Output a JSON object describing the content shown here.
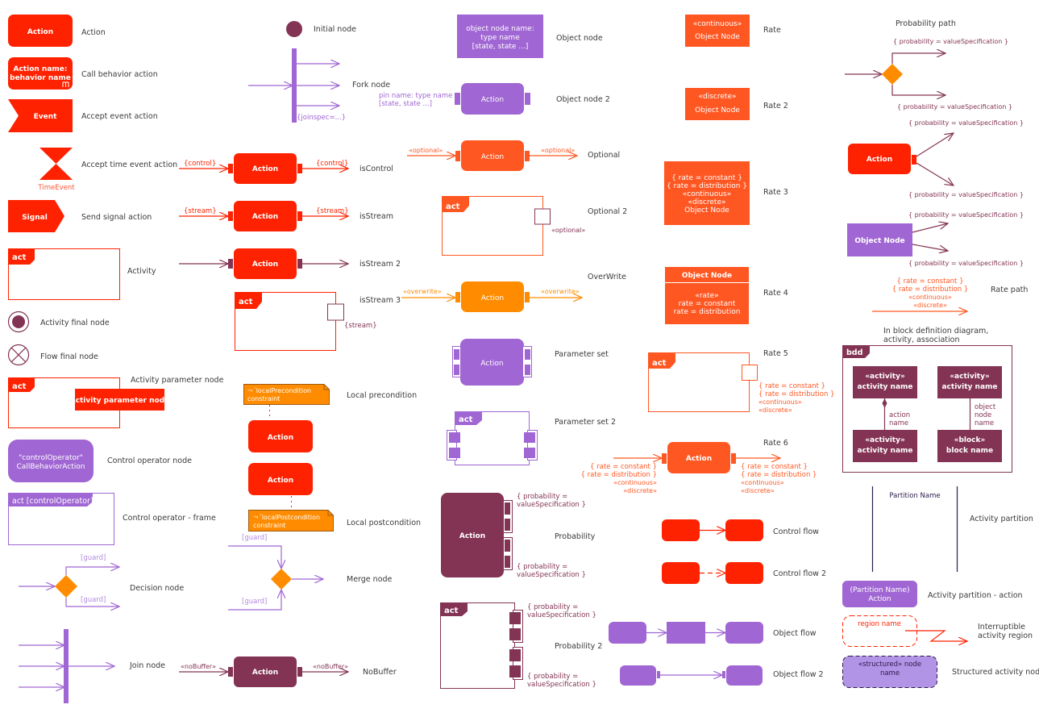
{
  "colors": {
    "red": "#ff2200",
    "orange": "#ff8c00",
    "coral": "#ff5722",
    "purple": "#a066d3",
    "plum": "#833454",
    "light_purple": "#b294e6",
    "text": "#3a3a3a"
  },
  "col1": {
    "action": {
      "shape": "Action",
      "label": "Action"
    },
    "call_behavior": {
      "shape_line1": "Action name:",
      "shape_line2": "behavior name",
      "label": "Call behavior action"
    },
    "accept_event": {
      "shape": "Event",
      "label": "Accept event action"
    },
    "accept_time": {
      "caption": "TimeEvent",
      "label": "Accept time event action"
    },
    "send_signal": {
      "shape": "Signal",
      "label": "Send signal action"
    },
    "activity": {
      "tag": "act",
      "label": "Activity"
    },
    "activity_final": {
      "label": "Activity final node"
    },
    "flow_final": {
      "label": "Flow final node"
    },
    "activity_param": {
      "tag": "act",
      "shape": "Activity parameter node",
      "label": "Activity parameter node"
    },
    "control_operator": {
      "line1": "\"controlOperator\"",
      "line2": "CallBehaviorAction",
      "label": "Control operator node"
    },
    "control_frame": {
      "tag": "act  [controlOperator]",
      "label": "Control operator - frame"
    },
    "decision": {
      "guard_top": "[guard]",
      "guard_bottom": "[guard]",
      "label": "Decision node"
    },
    "join": {
      "label": "Join node"
    }
  },
  "col2": {
    "initial": {
      "label": "Initial node"
    },
    "fork": {
      "spec": "{joinspec=...}",
      "label": "Fork node"
    },
    "is_control": {
      "in": "{control}",
      "out": "{control}",
      "shape": "Action",
      "label": "isControl"
    },
    "is_stream": {
      "in": "{stream}",
      "out": "{stream}",
      "shape": "Action",
      "label": "isStream"
    },
    "is_stream2": {
      "shape": "Action",
      "label": "isStream 2"
    },
    "is_stream3": {
      "tag": "act",
      "note": "{stream}",
      "label": "isStream 3"
    },
    "local_pre": {
      "note_line1": "¬´localPrecondition",
      "note_line2": "constraint",
      "shape": "Action",
      "label": "Local precondition"
    },
    "local_post": {
      "note_line1": "¬´localPostcondition",
      "note_line2": "constraint",
      "shape": "Action",
      "label": "Local postcondition"
    },
    "merge": {
      "guard_top": "[guard]",
      "guard_bottom": "[guard]",
      "label": "Merge node"
    },
    "no_buffer": {
      "in": "«noBuffer»",
      "out": "«noBuffer»",
      "shape": "Action",
      "label": "NoBuffer"
    }
  },
  "col3": {
    "object_node": {
      "line1": "object node name:",
      "line2": "type name",
      "line3": "[state, state ...]",
      "label": "Object node"
    },
    "object_node2": {
      "pin_line1": "pin name: type name",
      "pin_line2": "[state, state ...]",
      "shape": "Action",
      "label": "Object node 2"
    },
    "optional": {
      "in": "«optional»",
      "out": "«optional»",
      "shape": "Action",
      "label": "Optional"
    },
    "optional2": {
      "tag": "act",
      "note": "«optional»",
      "label": "Optional 2"
    },
    "overwrite": {
      "in": "«overwrite»",
      "out": "«overwrite»",
      "shape": "Action",
      "label": "OverWrite"
    },
    "param_set": {
      "shape": "Action",
      "label": "Parameter set"
    },
    "param_set2": {
      "tag": "act",
      "label": "Parameter set 2"
    },
    "probability": {
      "shape": "Action",
      "top_line1": "{ probability =",
      "top_line2": "valueSpecification }",
      "bottom_line1": "{ probability =",
      "bottom_line2": "valueSpecification }",
      "label": "Probability"
    },
    "probability2": {
      "tag": "act",
      "top_line1": "{ probability =",
      "top_line2": "valueSpecification }",
      "bottom_line1": "{ probability =",
      "bottom_line2": "valueSpecification }",
      "label": "Probability 2"
    }
  },
  "col4": {
    "rate": {
      "line1": "«continuous»",
      "line2": "Object Node",
      "label": "Rate"
    },
    "rate2": {
      "line1": "«discrete»",
      "line2": "Object Node",
      "label": "Rate 2"
    },
    "rate3": {
      "lines": [
        "{ rate = constant }",
        "{ rate = distribution }",
        "«continuous»",
        "«discrete»",
        "Object Node"
      ],
      "label": "Rate 3"
    },
    "rate4": {
      "header": "Object Node",
      "lines": [
        "«rate»",
        "rate = constant",
        "rate = distribution"
      ],
      "label": "Rate 4"
    },
    "rate5": {
      "tag": "act",
      "lines": [
        "{ rate = constant }",
        "{ rate = distribution }",
        "«continuous»",
        "«discrete»"
      ],
      "label": "Rate 5"
    },
    "rate6": {
      "shape": "Action",
      "left_lines": [
        "{ rate = constant }",
        "{ rate = distribution }",
        "«continuous»",
        "«discrete»"
      ],
      "right_lines": [
        "{ rate = constant }",
        "{ rate = distribution }",
        "«continuous»",
        "«discrete»"
      ],
      "label": "Rate 6"
    },
    "control_flow": {
      "label": "Control flow"
    },
    "control_flow2": {
      "label": "Control flow 2"
    },
    "object_flow": {
      "label": "Object flow"
    },
    "object_flow2": {
      "label": "Object flow 2"
    }
  },
  "col5": {
    "prob_path": {
      "title": "Probability path",
      "top": "{ probability = valueSpecification }",
      "bottom": "{ probability = valueSpecification }"
    },
    "prob_action": {
      "shape": "Action",
      "top": "{ probability = valueSpecification }",
      "bottom": "{ probability = valueSpecification }"
    },
    "prob_object": {
      "shape": "Object Node",
      "top": "{ probability = valueSpecification }",
      "bottom": "{ probability = valueSpecification }"
    },
    "rate_path": {
      "lines": [
        "{ rate = constant }",
        "{ rate = distribution }",
        "«continuous»",
        "«discrete»"
      ],
      "label": "Rate path"
    },
    "bdd": {
      "caption_line1": "In block definition diagram,",
      "caption_line2": "activity, association",
      "tag": "bdd",
      "box_tl": {
        "stereo": "«activity»",
        "name": "activity name"
      },
      "box_tr": {
        "stereo": "«activity»",
        "name": "activity name"
      },
      "box_bl": {
        "stereo": "«activity»",
        "name": "activity name"
      },
      "box_br": {
        "stereo": "«block»",
        "name": "block name"
      },
      "assoc_left": [
        "action",
        "name"
      ],
      "assoc_right": [
        "object",
        "node",
        "name"
      ]
    },
    "partition": {
      "name": "Partition Name",
      "label": "Activity partition"
    },
    "partition_action": {
      "line1": "(Partition Name)",
      "line2": "Action",
      "label": "Activity partition - action"
    },
    "interruptible": {
      "region": "region name",
      "label_line1": "Interruptible",
      "label_line2": "activity region"
    },
    "structured": {
      "line1": "«structured» node",
      "line2": "name",
      "label": "Structured activity node"
    }
  }
}
